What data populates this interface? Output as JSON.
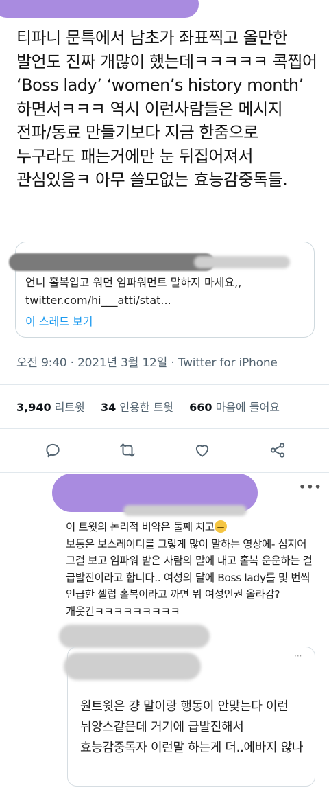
{
  "tweet": {
    "body": "티파니 문특에서 남초가 좌표찍고 올만한 발언도 진짜 개많이 했는데ㅋㅋㅋㅋㅋ 콕찝어 ‘Boss lady’ ‘women’s history month’ 하면서ㅋㅋㅋ 역시 이런사람들은 메시지 전파/동료 만들기보다 지금 한줌으로 누구라도 패는거에만 눈 뒤집어져서 관심있음ㅋ 아무 쓸모없는 효능감중독들.",
    "quote": {
      "text": "언니 홀복입고 워먼 임파워먼트 말하지 마세요,, twitter.com/hi___atti/stat...",
      "link": "이 스레드 보기"
    },
    "timestamp": "오전 9:40 · 2021년 3월 12일 · Twitter for iPhone",
    "stats": {
      "retweets_count": "3,940",
      "retweets_label": "리트윗",
      "quotes_count": "34",
      "quotes_label": "인용한 트윗",
      "likes_count": "660",
      "likes_label": "마음에 들어요"
    },
    "actions": [
      {
        "icon": "reply-icon"
      },
      {
        "icon": "retweet-icon"
      },
      {
        "icon": "like-icon"
      },
      {
        "icon": "share-icon"
      }
    ]
  },
  "reply": {
    "more": "•••",
    "text_line1": "이 트윗의 논리적 비약은 둘째 치고",
    "emoji": "😓",
    "text_rest": "보통은 보스레이디를 그렇게 많이 말하는 영상에- 심지어 그걸 보고 임파워 받은 사람의 말에 대고 홀복 운운하는 걸 급발진이라고 합니다.. 여성의 달에 Boss lady를 몇 번씩 언급한 셀럽 홀복이라고 까면 뭐 여성인권 올라감? 개웃긴ㅋㅋㅋㅋㅋㅋㅋㅋㅋ",
    "quote": {
      "more": "···",
      "text": "원트윗은 걍 말이랑 행동이 안맞는다 이런 뉘앙스같은데 거기에 급발진해서 효능감중독자 이런말 하는게 더..에바지 않나"
    }
  },
  "colors": {
    "link": "#1d9bf0",
    "secondary_text": "#536471",
    "redaction": "#a98be0"
  }
}
